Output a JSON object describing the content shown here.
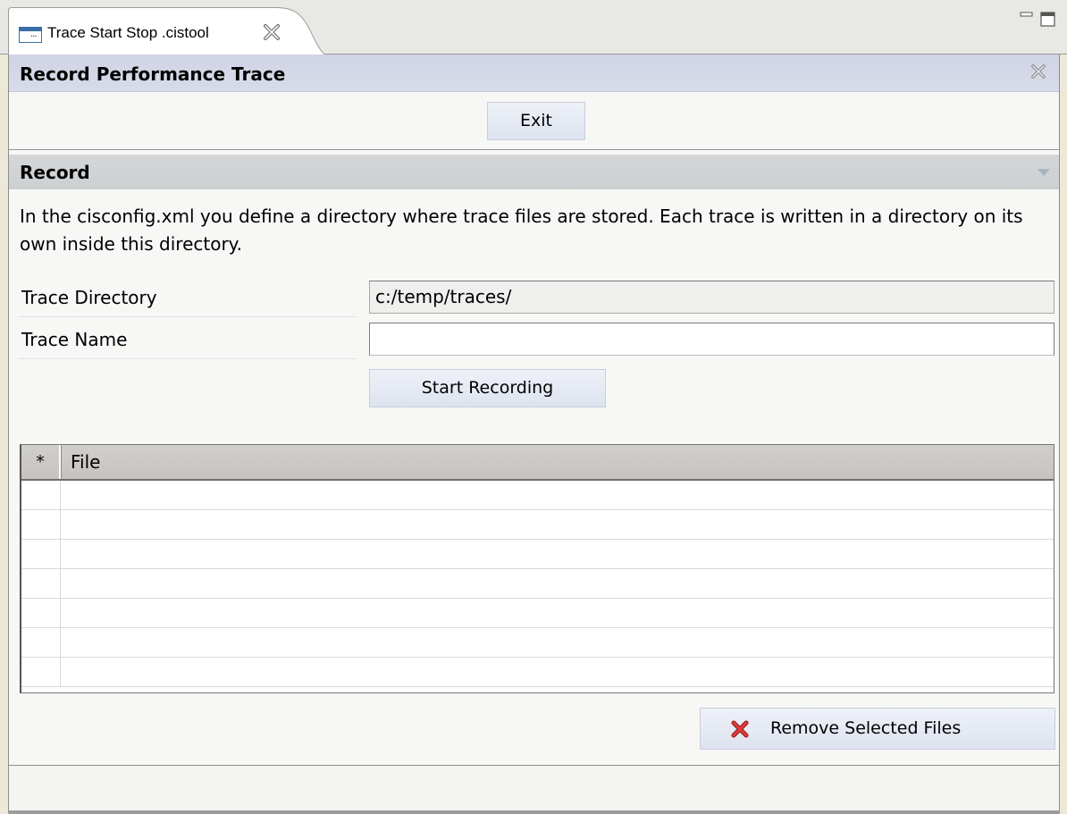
{
  "editor": {
    "tab_title": "Trace Start Stop .cistool",
    "tab_icon": "editor-file-icon",
    "close_icon": "close-x-icon",
    "minimize_icon": "minimize-icon",
    "maximize_icon": "maximize-icon"
  },
  "form": {
    "title": "Record Performance Trace",
    "exit_label": "Exit"
  },
  "record_section": {
    "title": "Record",
    "description": "In the cisconfig.xml you define a directory where trace files are stored. Each trace is written in a directory on its own inside this directory.",
    "trace_directory_label": "Trace Directory",
    "trace_directory_value": "c:/temp/traces/",
    "trace_name_label": "Trace Name",
    "trace_name_value": "",
    "start_recording_label": "Start Recording"
  },
  "file_table": {
    "columns": [
      "*",
      "File"
    ],
    "rows": []
  },
  "actions": {
    "remove_label": "Remove Selected Files",
    "remove_icon": "red-x-delete-icon"
  },
  "colors": {
    "form_header": "#d4d7e7",
    "section_header": "#d0d2d4",
    "button": "#e3e8f2",
    "remove_icon": "#cc2a2a"
  }
}
